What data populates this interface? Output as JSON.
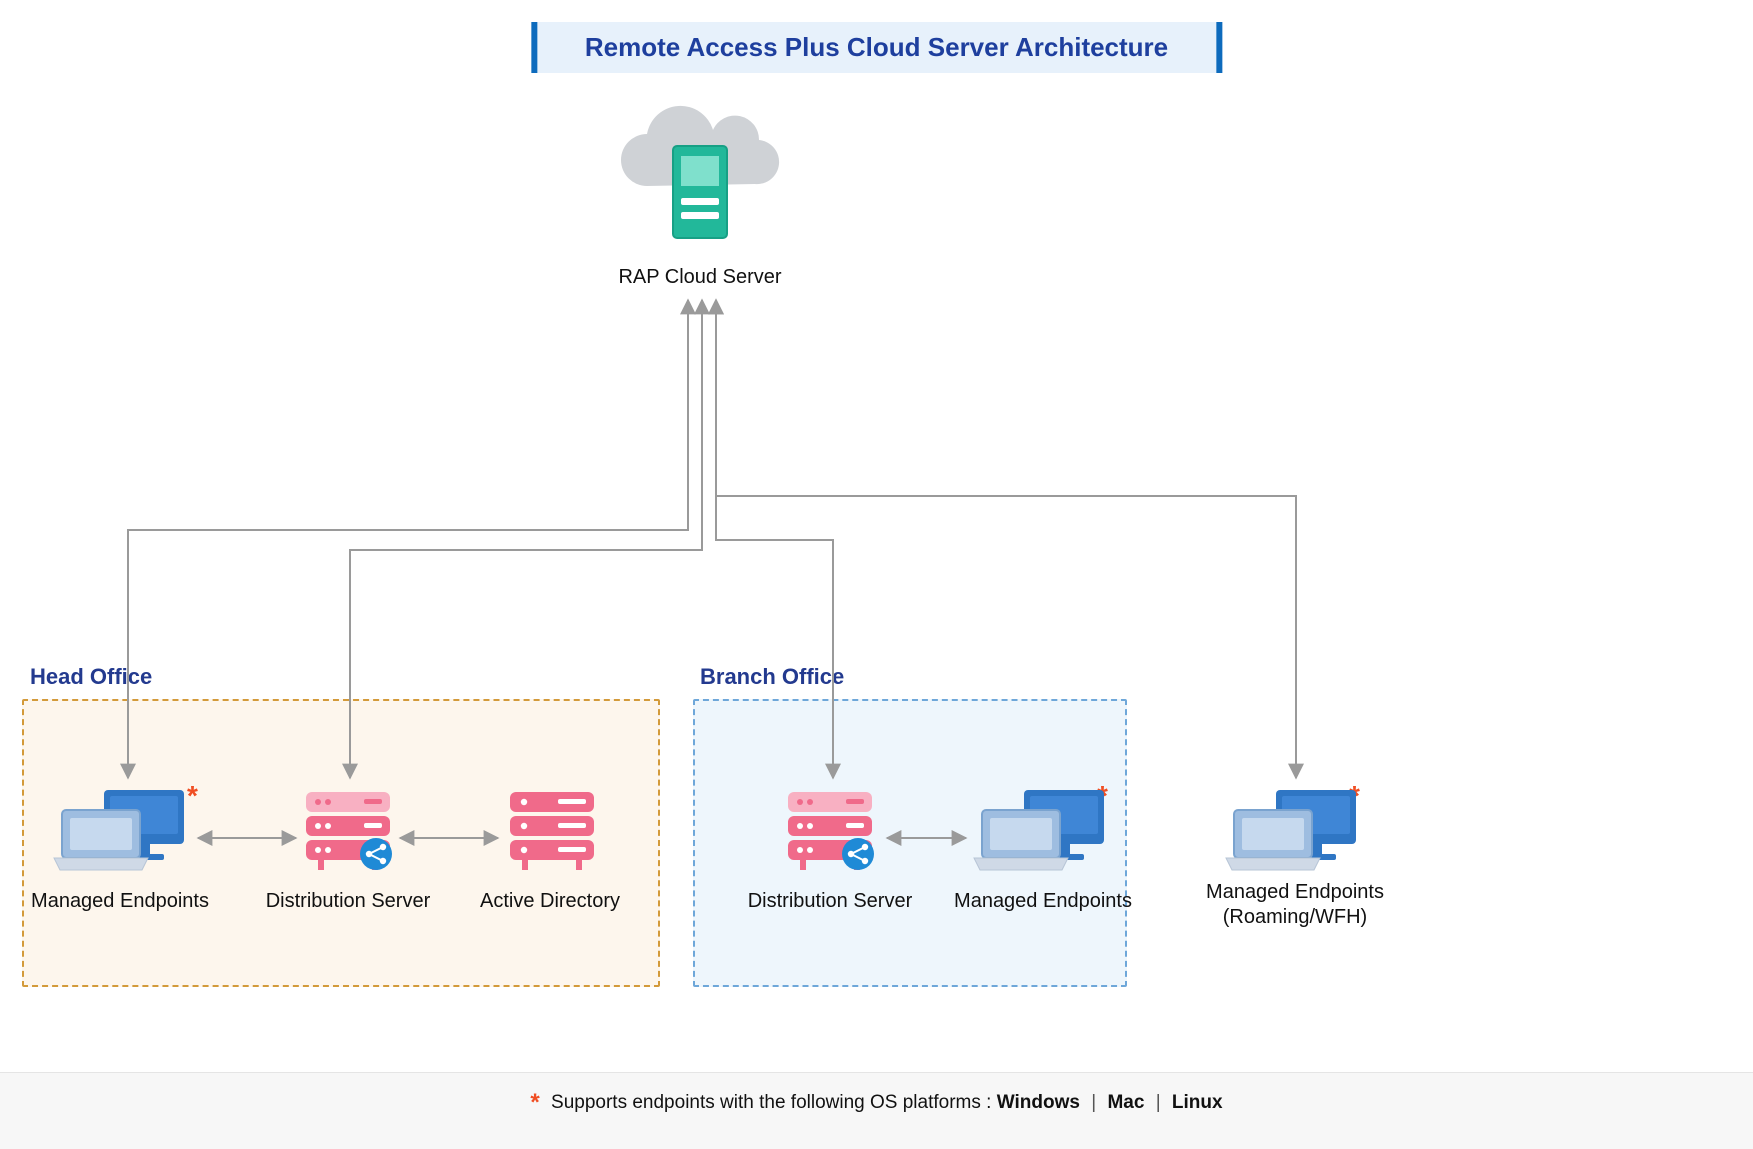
{
  "title": "Remote Access Plus Cloud Server Architecture",
  "cloud_server_label": "RAP Cloud Server",
  "groups": {
    "head_office": {
      "title": "Head Office"
    },
    "branch_office": {
      "title": "Branch Office"
    }
  },
  "nodes": {
    "ho_endpoints": {
      "label": "Managed Endpoints"
    },
    "ho_dist": {
      "label": "Distribution Server"
    },
    "ho_ad": {
      "label": "Active Directory"
    },
    "bo_dist": {
      "label": "Distribution Server"
    },
    "bo_endpoints": {
      "label": "Managed Endpoints"
    },
    "roaming": {
      "label_line1": "Managed Endpoints",
      "label_line2": "(Roaming/WFH)"
    }
  },
  "footer": {
    "prefix": "Supports endpoints with the following OS platforms :",
    "platforms": [
      "Windows",
      "Mac",
      "Linux"
    ]
  },
  "colors": {
    "title_bg": "#e7f1fb",
    "title_accent": "#0d6bbd",
    "title_text": "#1e3f9e",
    "head_office_border": "#d39a3a",
    "head_office_bg": "#fdf6ed",
    "branch_office_border": "#6ea7d9",
    "branch_office_bg": "#eef6fc",
    "asterisk": "#f04e23",
    "endpoint_blue": "#2f76c4",
    "endpoint_blue_light": "#9ebde0",
    "server_pink": "#f06a8a",
    "server_pink_light": "#f8b0c2",
    "share_badge": "#1f8ad6",
    "cloud_gray": "#cfd2d6",
    "cloud_server_green": "#22b89a",
    "arrow_gray": "#9a9a9a"
  }
}
